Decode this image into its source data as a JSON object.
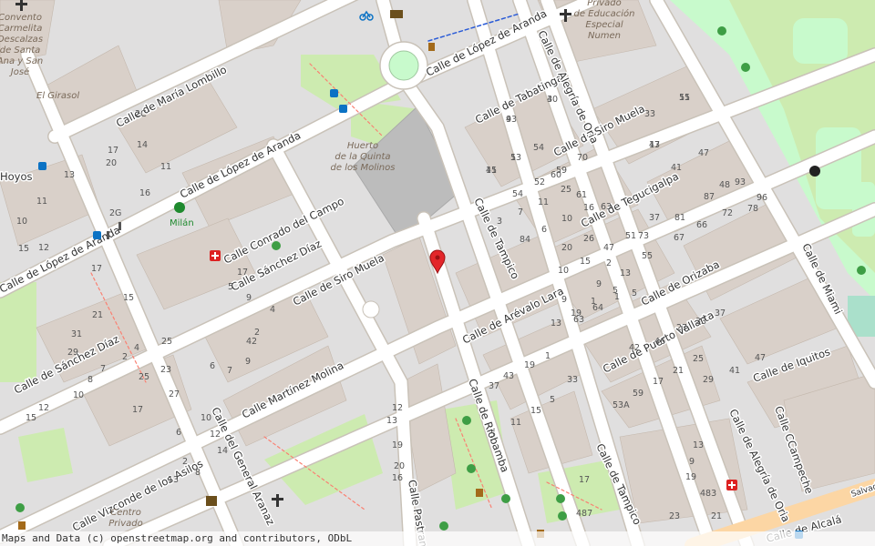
{
  "map": {
    "colors": {
      "background": "#f2efe9",
      "residential": "#e0dfdf",
      "building": "#d9d0c9",
      "road": "#ffffff",
      "road_casing": "#c9c2b8",
      "park": "#c8facc",
      "grass": "#cdebb0",
      "pitch": "#aae0cb",
      "square": "#bcbcbc",
      "footway": "#fa8072",
      "marker": "#e3262a",
      "main_road": "#fcd6a4"
    },
    "streets": [
      "Calle de López de Aranda",
      "Calle de López de Aranda",
      "Calle de López de Aranda",
      "Calle de María Lombillo",
      "Calle Conrado del Campo",
      "Calle Sánchez Díaz",
      "Calle de Sánchez Díaz",
      "Calle de Siro Muela",
      "Calle de Siro Muela",
      "Calle Martínez Molina",
      "Calle Vizconde de los Asilos",
      "Calle del General Aranaz",
      "Calle de Tabatinga",
      "Calle de Tegucigalpa",
      "Calle de Alegría de Oria",
      "Calle de Alegría de Oria",
      "Calle de Tampico",
      "Calle de Tampico",
      "Calle de Arévalo Lara",
      "Calle de Orizaba",
      "Calle de Puerto Vallarta",
      "Calle de Iquitos",
      "Calle de Riobamba",
      "Calle Pastrana",
      "Calle de Miami",
      "Calle CCampeche",
      "Calle de Alcalá",
      "Hoyos",
      "Salvado"
    ],
    "pois": {
      "convento": [
        "Convento",
        "Carmelita",
        "Descalzas",
        "de Santa",
        "Ana y San",
        "José"
      ],
      "colegio": [
        "Privado",
        "de Educación",
        "Especial",
        "Numen"
      ],
      "huerto": [
        "Huerto",
        "de la Quinta",
        "de los Molinos"
      ],
      "centro": [
        "Centro",
        "Privado"
      ],
      "el_girasol": "El Girasol",
      "milan": "Milán"
    },
    "house_numbers": [
      "30",
      "43",
      "55",
      "47",
      "41",
      "53",
      "54",
      "60",
      "70",
      "33",
      "41",
      "47",
      "48",
      "54",
      "52",
      "59",
      "61",
      "63",
      "73",
      "81",
      "87",
      "93",
      "96",
      "3",
      "7",
      "11",
      "25",
      "37",
      "67",
      "66",
      "72",
      "78",
      "84",
      "6",
      "10",
      "16",
      "20",
      "26",
      "2",
      "10",
      "15",
      "47",
      "51",
      "55",
      "63",
      "64",
      "1",
      "5",
      "9",
      "13",
      "19",
      "1",
      "5",
      "9",
      "13",
      "42",
      "46",
      "27",
      "33",
      "37",
      "41",
      "47",
      "53A",
      "59",
      "17",
      "21",
      "25",
      "29",
      "33",
      "37",
      "43",
      "19",
      "1",
      "5",
      "11",
      "15",
      "5",
      "9",
      "11",
      "13",
      "15",
      "12",
      "10",
      "20",
      "17",
      "14",
      "11",
      "16",
      "2C",
      "2G",
      "17",
      "5",
      "42",
      "2",
      "4",
      "6",
      "7",
      "9",
      "12",
      "13",
      "19",
      "21",
      "17",
      "25",
      "15",
      "31",
      "29",
      "23",
      "27",
      "25",
      "17",
      "15",
      "12",
      "10",
      "8",
      "7",
      "2",
      "4",
      "6",
      "2",
      "8",
      "10",
      "12",
      "13",
      "14",
      "16",
      "20",
      "23",
      "21",
      "17",
      "13",
      "9",
      "19",
      "483",
      "487",
      "4",
      "9",
      "11",
      "13",
      "15",
      "1"
    ],
    "marker_label": "location-marker"
  },
  "attribution": "Maps and Data (c) openstreetmap.org and contributors, ODbL"
}
